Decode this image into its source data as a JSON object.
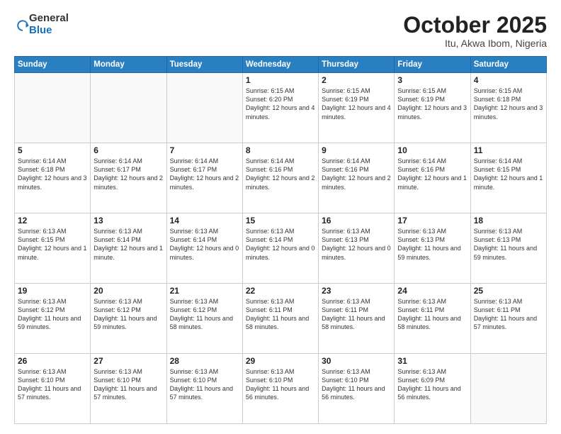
{
  "logo": {
    "general": "General",
    "blue": "Blue"
  },
  "title": {
    "month": "October 2025",
    "location": "Itu, Akwa Ibom, Nigeria"
  },
  "weekdays": [
    "Sunday",
    "Monday",
    "Tuesday",
    "Wednesday",
    "Thursday",
    "Friday",
    "Saturday"
  ],
  "weeks": [
    [
      {
        "day": "",
        "info": ""
      },
      {
        "day": "",
        "info": ""
      },
      {
        "day": "",
        "info": ""
      },
      {
        "day": "1",
        "info": "Sunrise: 6:15 AM\nSunset: 6:20 PM\nDaylight: 12 hours\nand 4 minutes."
      },
      {
        "day": "2",
        "info": "Sunrise: 6:15 AM\nSunset: 6:19 PM\nDaylight: 12 hours\nand 4 minutes."
      },
      {
        "day": "3",
        "info": "Sunrise: 6:15 AM\nSunset: 6:19 PM\nDaylight: 12 hours\nand 3 minutes."
      },
      {
        "day": "4",
        "info": "Sunrise: 6:15 AM\nSunset: 6:18 PM\nDaylight: 12 hours\nand 3 minutes."
      }
    ],
    [
      {
        "day": "5",
        "info": "Sunrise: 6:14 AM\nSunset: 6:18 PM\nDaylight: 12 hours\nand 3 minutes."
      },
      {
        "day": "6",
        "info": "Sunrise: 6:14 AM\nSunset: 6:17 PM\nDaylight: 12 hours\nand 2 minutes."
      },
      {
        "day": "7",
        "info": "Sunrise: 6:14 AM\nSunset: 6:17 PM\nDaylight: 12 hours\nand 2 minutes."
      },
      {
        "day": "8",
        "info": "Sunrise: 6:14 AM\nSunset: 6:16 PM\nDaylight: 12 hours\nand 2 minutes."
      },
      {
        "day": "9",
        "info": "Sunrise: 6:14 AM\nSunset: 6:16 PM\nDaylight: 12 hours\nand 2 minutes."
      },
      {
        "day": "10",
        "info": "Sunrise: 6:14 AM\nSunset: 6:16 PM\nDaylight: 12 hours\nand 1 minute."
      },
      {
        "day": "11",
        "info": "Sunrise: 6:14 AM\nSunset: 6:15 PM\nDaylight: 12 hours\nand 1 minute."
      }
    ],
    [
      {
        "day": "12",
        "info": "Sunrise: 6:13 AM\nSunset: 6:15 PM\nDaylight: 12 hours\nand 1 minute."
      },
      {
        "day": "13",
        "info": "Sunrise: 6:13 AM\nSunset: 6:14 PM\nDaylight: 12 hours\nand 1 minute."
      },
      {
        "day": "14",
        "info": "Sunrise: 6:13 AM\nSunset: 6:14 PM\nDaylight: 12 hours\nand 0 minutes."
      },
      {
        "day": "15",
        "info": "Sunrise: 6:13 AM\nSunset: 6:14 PM\nDaylight: 12 hours\nand 0 minutes."
      },
      {
        "day": "16",
        "info": "Sunrise: 6:13 AM\nSunset: 6:13 PM\nDaylight: 12 hours\nand 0 minutes."
      },
      {
        "day": "17",
        "info": "Sunrise: 6:13 AM\nSunset: 6:13 PM\nDaylight: 11 hours\nand 59 minutes."
      },
      {
        "day": "18",
        "info": "Sunrise: 6:13 AM\nSunset: 6:13 PM\nDaylight: 11 hours\nand 59 minutes."
      }
    ],
    [
      {
        "day": "19",
        "info": "Sunrise: 6:13 AM\nSunset: 6:12 PM\nDaylight: 11 hours\nand 59 minutes."
      },
      {
        "day": "20",
        "info": "Sunrise: 6:13 AM\nSunset: 6:12 PM\nDaylight: 11 hours\nand 59 minutes."
      },
      {
        "day": "21",
        "info": "Sunrise: 6:13 AM\nSunset: 6:12 PM\nDaylight: 11 hours\nand 58 minutes."
      },
      {
        "day": "22",
        "info": "Sunrise: 6:13 AM\nSunset: 6:11 PM\nDaylight: 11 hours\nand 58 minutes."
      },
      {
        "day": "23",
        "info": "Sunrise: 6:13 AM\nSunset: 6:11 PM\nDaylight: 11 hours\nand 58 minutes."
      },
      {
        "day": "24",
        "info": "Sunrise: 6:13 AM\nSunset: 6:11 PM\nDaylight: 11 hours\nand 58 minutes."
      },
      {
        "day": "25",
        "info": "Sunrise: 6:13 AM\nSunset: 6:11 PM\nDaylight: 11 hours\nand 57 minutes."
      }
    ],
    [
      {
        "day": "26",
        "info": "Sunrise: 6:13 AM\nSunset: 6:10 PM\nDaylight: 11 hours\nand 57 minutes."
      },
      {
        "day": "27",
        "info": "Sunrise: 6:13 AM\nSunset: 6:10 PM\nDaylight: 11 hours\nand 57 minutes."
      },
      {
        "day": "28",
        "info": "Sunrise: 6:13 AM\nSunset: 6:10 PM\nDaylight: 11 hours\nand 57 minutes."
      },
      {
        "day": "29",
        "info": "Sunrise: 6:13 AM\nSunset: 6:10 PM\nDaylight: 11 hours\nand 56 minutes."
      },
      {
        "day": "30",
        "info": "Sunrise: 6:13 AM\nSunset: 6:10 PM\nDaylight: 11 hours\nand 56 minutes."
      },
      {
        "day": "31",
        "info": "Sunrise: 6:13 AM\nSunset: 6:09 PM\nDaylight: 11 hours\nand 56 minutes."
      },
      {
        "day": "",
        "info": ""
      }
    ]
  ]
}
